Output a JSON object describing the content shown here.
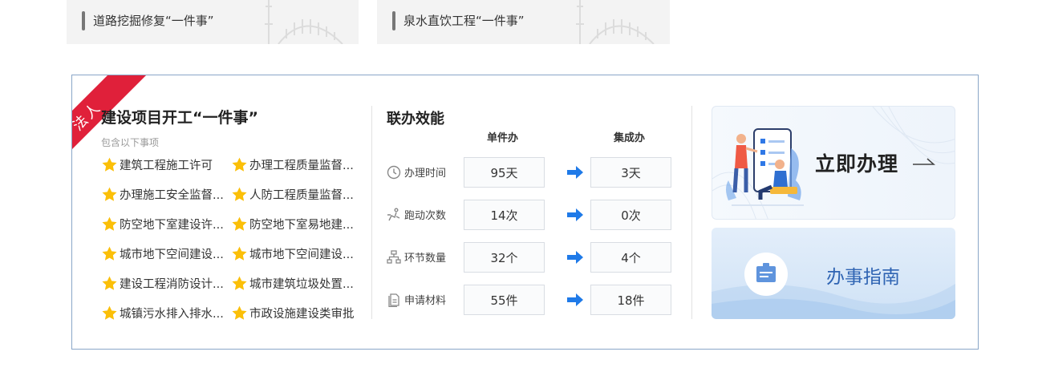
{
  "top_cards": [
    {
      "label": "道路挖掘修复“一件事”"
    },
    {
      "label": "泉水直饮工程“一件事”"
    }
  ],
  "ribbon": {
    "label": "法人"
  },
  "project": {
    "title": "建设项目开工“一件事”",
    "subtitle": "包含以下事项",
    "items": [
      "建筑工程施工许可",
      "办理工程质量监督...",
      "办理施工安全监督...",
      "人防工程质量监督...",
      "防空地下室建设许...",
      "防空地下室易地建...",
      "城市地下空间建设...",
      "城市地下空间建设...",
      "建设工程消防设计...",
      "城市建筑垃圾处置...",
      "城镇污水排入排水...",
      "市政设施建设类审批"
    ]
  },
  "efficiency": {
    "title": "联办效能",
    "col_single": "单件办",
    "col_integrated": "集成办",
    "rows": [
      {
        "icon": "clock-icon",
        "label": "办理时间",
        "single": "95天",
        "integrated": "3天"
      },
      {
        "icon": "running-icon",
        "label": "跑动次数",
        "single": "14次",
        "integrated": "0次"
      },
      {
        "icon": "hierarchy-icon",
        "label": "环节数量",
        "single": "32个",
        "integrated": "4个"
      },
      {
        "icon": "document-icon",
        "label": "申请材料",
        "single": "55件",
        "integrated": "18件"
      }
    ]
  },
  "actions": {
    "apply": {
      "label": "立即办理"
    },
    "guide": {
      "label": "办事指南"
    }
  },
  "colors": {
    "ribbon": "#e0203a",
    "star": "#fbbf08",
    "arrow": "#1f7ae8",
    "guide_text": "#2f64b3",
    "panel_border": "#8aa6c8"
  }
}
